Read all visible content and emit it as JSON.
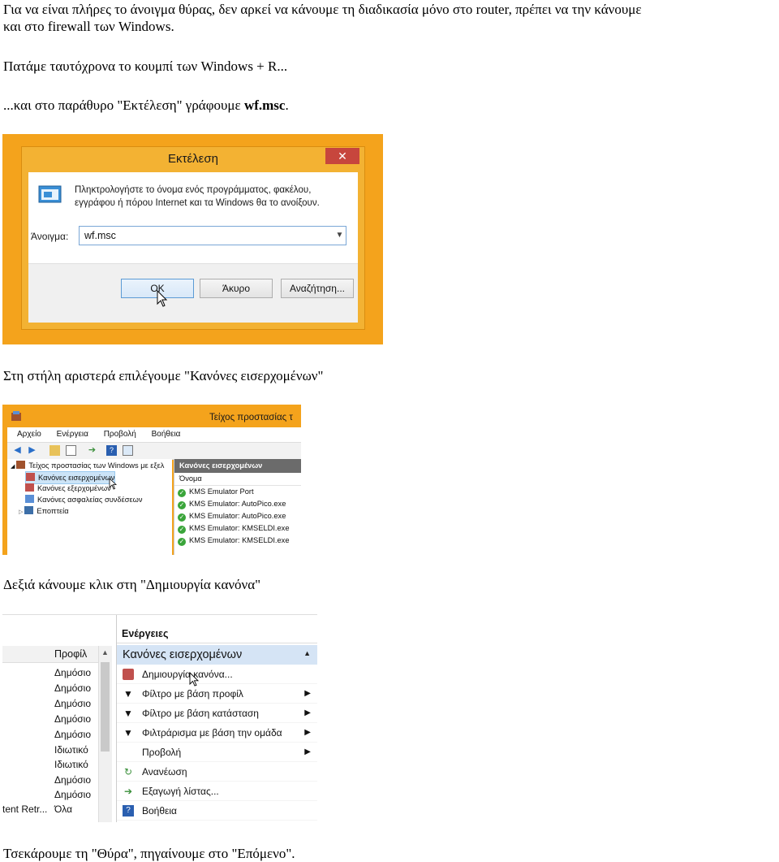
{
  "paragraphs": {
    "intro_line1": "Για να είναι πλήρες το άνοιγμα θύρας, δεν αρκεί να κάνουμε τη διαδικασία μόνο στο router, πρέπει να την κάνουμε",
    "intro_line2": "και στο firewall των Windows.",
    "step1": "Πατάμε ταυτόχρονα το κουμπί των Windows + R...",
    "step2_prefix": "...και στο παράθυρο \"Εκτέλεση\" γράφουμε ",
    "step2_bold": "wf.msc",
    "step2_suffix": ".",
    "step3": "Στη στήλη αριστερά επιλέγουμε \"Κανόνες εισερχομένων\"",
    "step4": "Δεξιά κάνουμε κλικ στη \"Δημιουργία κανόνα\"",
    "step5": "Τσεκάρουμε τη \"Θύρα\", πηγαίνουμε στο \"Επόμενο\"."
  },
  "run_dialog": {
    "title": "Εκτέλεση",
    "close_glyph": "✕",
    "description": "Πληκτρολογήστε το όνομα ενός προγράμματος, φακέλου, εγγράφου ή πόρου Internet και τα Windows θα το ανοίξουν.",
    "open_label": "Άνοιγμα:",
    "open_value": "wf.msc",
    "ok_label": "OK",
    "cancel_label": "Άκυρο",
    "browse_label": "Αναζήτηση...",
    "accent_color": "#f4a31c"
  },
  "firewall": {
    "window_title": "Τείχος προστασίας τ",
    "menu": [
      "Αρχείο",
      "Ενέργεια",
      "Προβολή",
      "Βοήθεια"
    ],
    "tree": [
      "Τείχος προστασίας των Windows με εξελ",
      "Κανόνες εισερχομένων",
      "Κανόνες εξερχομένων",
      "Κανόνες ασφαλείας συνδέσεων",
      "Εποπτεία"
    ],
    "rules_header": "Κανόνες εισερχομένων",
    "column_name": "Όνομα",
    "rules": [
      "KMS Emulator Port",
      "KMS Emulator: AutoPico.exe",
      "KMS Emulator: AutoPico.exe",
      "KMS Emulator: KMSELDI.exe",
      "KMS Emulator: KMSELDI.exe"
    ]
  },
  "actions": {
    "profile_header": "Προφίλ",
    "profiles": [
      "Δημόσιο",
      "Δημόσιο",
      "Δημόσιο",
      "Δημόσιο",
      "Δημόσιο",
      "Ιδιωτικό",
      "Ιδιωτικό",
      "Δημόσιο",
      "Δημόσιο"
    ],
    "bottom_left": "tent Retr...",
    "bottom_profile": "Όλα",
    "panel_header": "Ενέργειες",
    "section": "Κανόνες εισερχομένων",
    "items": [
      {
        "label": "Δημιουργία κανόνα...",
        "icon": "new-rule-icon",
        "submenu": false
      },
      {
        "label": "Φίλτρο με βάση προφίλ",
        "icon": "filter-icon",
        "submenu": true
      },
      {
        "label": "Φίλτρο με βάση κατάσταση",
        "icon": "filter-icon",
        "submenu": true
      },
      {
        "label": "Φιλτράρισμα με βάση την ομάδα",
        "icon": "filter-icon",
        "submenu": true
      },
      {
        "label": "Προβολή",
        "icon": "",
        "submenu": true
      },
      {
        "label": "Ανανέωση",
        "icon": "refresh-icon",
        "submenu": false
      },
      {
        "label": "Εξαγωγή λίστας...",
        "icon": "export-icon",
        "submenu": false
      },
      {
        "label": "Βοήθεια",
        "icon": "help-icon",
        "submenu": false
      }
    ]
  }
}
